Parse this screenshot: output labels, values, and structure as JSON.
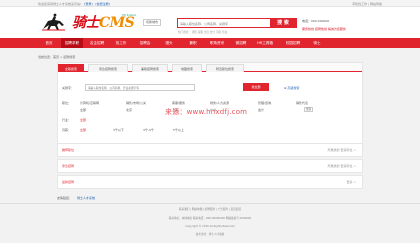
{
  "topbar": {
    "welcome": "欢迎您来到骑士人才系统演示站!",
    "login": "[登录]",
    "register": "[免费注册]",
    "right": "手机找工作 | 网站导航"
  },
  "header": {
    "logo_main": "骑士",
    "logo_cms": "CMS",
    "logo_sub": "HR System",
    "city": "切换城市",
    "search_placeholder": "请输入职位名称、公司名称、关键字",
    "search_button": "搜 索",
    "hot": "热门搜索：  销售  客服  文员  会计  司机  行政",
    "contact_line1": "电话：000-000000",
    "contact_line2": "服务热线 招聘热线 竭诚为您服务"
  },
  "nav": {
    "items": [
      "首页",
      "招聘求职",
      "名企招聘",
      "找工作",
      "招聘会",
      "猎头",
      "兼职",
      "职场资讯",
      "微招聘",
      "HR工具箱",
      "校园招聘",
      "骑士"
    ]
  },
  "breadcrumb": "当前位置：首页 > 招聘搜索",
  "search_tabs": [
    "全职搜索",
    "紧急招聘搜索",
    "兼职招聘搜索",
    "地图搜索",
    "附近职位搜索"
  ],
  "keyword": {
    "label": "关键字：",
    "placeholder": "请输入职位名称、公司名称、行业关键字等",
    "button": "搜全部",
    "advanced": "⊕ 高级搜索"
  },
  "filters": [
    {
      "label": "职位：",
      "values": [
        "计算机/互联网",
        "销售/市场/公关",
        "客服/服务",
        "财务/人力资源",
        "管理/咨询"
      ]
    },
    {
      "label": "地区：",
      "values": [
        "全部",
        "北京",
        "上海",
        "广州",
        "深圳",
        "其他"
      ]
    },
    {
      "label": "行业：",
      "values": [
        "全部",
        "IT/互联网",
        "金融",
        "房地产",
        "制造"
      ]
    },
    {
      "label": "月薪：",
      "values": [
        "全部",
        "3千以下",
        "3千-5千",
        "5千以上"
      ]
    }
  ],
  "filter_extra": {
    "col1a": "销售代表",
    "col1b": "业务员",
    "col2a": "人事专员",
    "col2b": "会计",
    "col3": "更多"
  },
  "watermark": "来源：www.hnxdfj.com",
  "sections": [
    {
      "left": "推荐职位",
      "right": "所属类别 更多职位 >"
    },
    {
      "left": "紧急招聘",
      "right": "所属类别 更多职位 >"
    },
    {
      "left": "最新招聘",
      "right": "更多 >"
    }
  ],
  "links": {
    "label": "友情链接：",
    "value": "骑士人才系统"
  },
  "footer": {
    "line1": "联系我们 | 网站地图 | 招聘服务 | 广告服务 | 意见反馈",
    "line2": "联系地址：本地地址 联系电话：000-00000000 网站备案号 0000000",
    "line3": "Copyright © 2016 All Rights Reserved",
    "line4": "技术支持：骑士人才系统"
  },
  "colors": {
    "accent": "#e0252f",
    "link": "#1a5fb4"
  }
}
